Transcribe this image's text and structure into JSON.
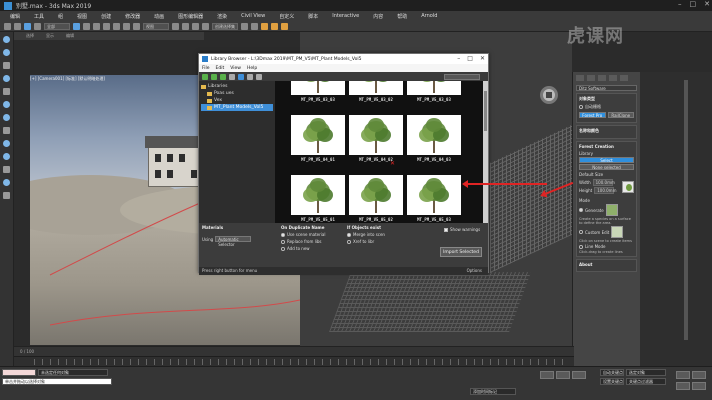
{
  "window": {
    "title": "别墅.max - 3ds Max 2019",
    "controls": [
      "–",
      "□",
      "✕"
    ]
  },
  "menubar": [
    "编辑",
    "工具",
    "组",
    "视图",
    "创建",
    "修改器",
    "动画",
    "图形编辑器",
    "渲染",
    "Civil View",
    "自定义",
    "脚本",
    "Interactive",
    "内容",
    "帮助",
    "Arnold"
  ],
  "toolbar": {
    "selection_filter": "全部",
    "view_dropdown": "视图",
    "snap_dropdown": "创建选择集"
  },
  "left_tabs": [
    "选择",
    "显示",
    "编辑"
  ],
  "viewport_left": {
    "label": "[+] [Camera001] [标准] [默认明暗处理]"
  },
  "watermark": "虎课网",
  "library": {
    "title": "Library Browser - L:\\3Dmax 2019\\MT_PM_V5\\MT_Plant Models_Vol5",
    "menu": [
      "File",
      "Edit",
      "View",
      "Help"
    ],
    "tree": [
      {
        "label": "Libraries",
        "selected": false
      },
      {
        "label": "Poas ues",
        "selected": false
      },
      {
        "label": "Vex",
        "selected": false
      },
      {
        "label": "MT_Plant Models_Vol5",
        "selected": true
      }
    ],
    "tiles": [
      {
        "caption": "MT_PM_V5_03_03"
      },
      {
        "caption": "MT_PM_V5_03_02"
      },
      {
        "caption": "MT_PM_V5_03_03"
      },
      {
        "caption": "MT_PM_V5_04_01"
      },
      {
        "caption": "MT_PM_V5_04_02"
      },
      {
        "caption": "MT_PM_V5_04_03"
      },
      {
        "caption": "MT_PM_V5_05_01"
      },
      {
        "caption": "MT_PM_V5_05_02"
      },
      {
        "caption": "MT_PM_V5_05_03"
      }
    ],
    "bottom": {
      "materials_header": "Materials",
      "using_label": "Using",
      "using_value": "Automatic Selector",
      "duplicate_header": "On Duplicate Name",
      "dup_options": [
        "Use scene material",
        "Replace from libs",
        "Add to new"
      ],
      "objects_header": "If Objects exist",
      "obj_options": [
        "Merge into scen",
        "Xref to libr"
      ],
      "show_warnings": "Show warnings",
      "import_button": "Import Selected",
      "status": "Press right button for menu",
      "options": "Options"
    }
  },
  "command_panel": {
    "category": "Ditz Software",
    "section1_title": "对象类型",
    "autogrid": "自动栅格",
    "btn_forest": "Forest Pro",
    "btn_railclone": "RailClone",
    "section2_title": "名称和颜色",
    "forest_creation_title": "Forest Creation",
    "library_label": "Library",
    "select_btn": "Select",
    "none_selected": "None selected",
    "default_size_label": "Default Size",
    "width_label": "Width",
    "width_value": "100.0mm",
    "height_label": "Height",
    "height_value": "100.0mm",
    "mode_label": "Mode",
    "generate_label": "Generate",
    "generate_desc": "Create a species on a surface to define the area.",
    "custom_edit": "Custom Edit",
    "custom_desc": "Click on scene to create items",
    "line_mode": "Line Mode",
    "line_desc": "Click-drag to create lines",
    "about_title": "About"
  },
  "timeline": {
    "frame": "0 / 100"
  },
  "status": {
    "selection": "未选定任何对象",
    "prompt": "单击并拖动以选择对象",
    "add_time_tag": "添加时间标记",
    "autokey": "自动关键点",
    "setkey": "设置关键点",
    "filter": "选定对象",
    "key_filters": "关键点过滤器"
  }
}
